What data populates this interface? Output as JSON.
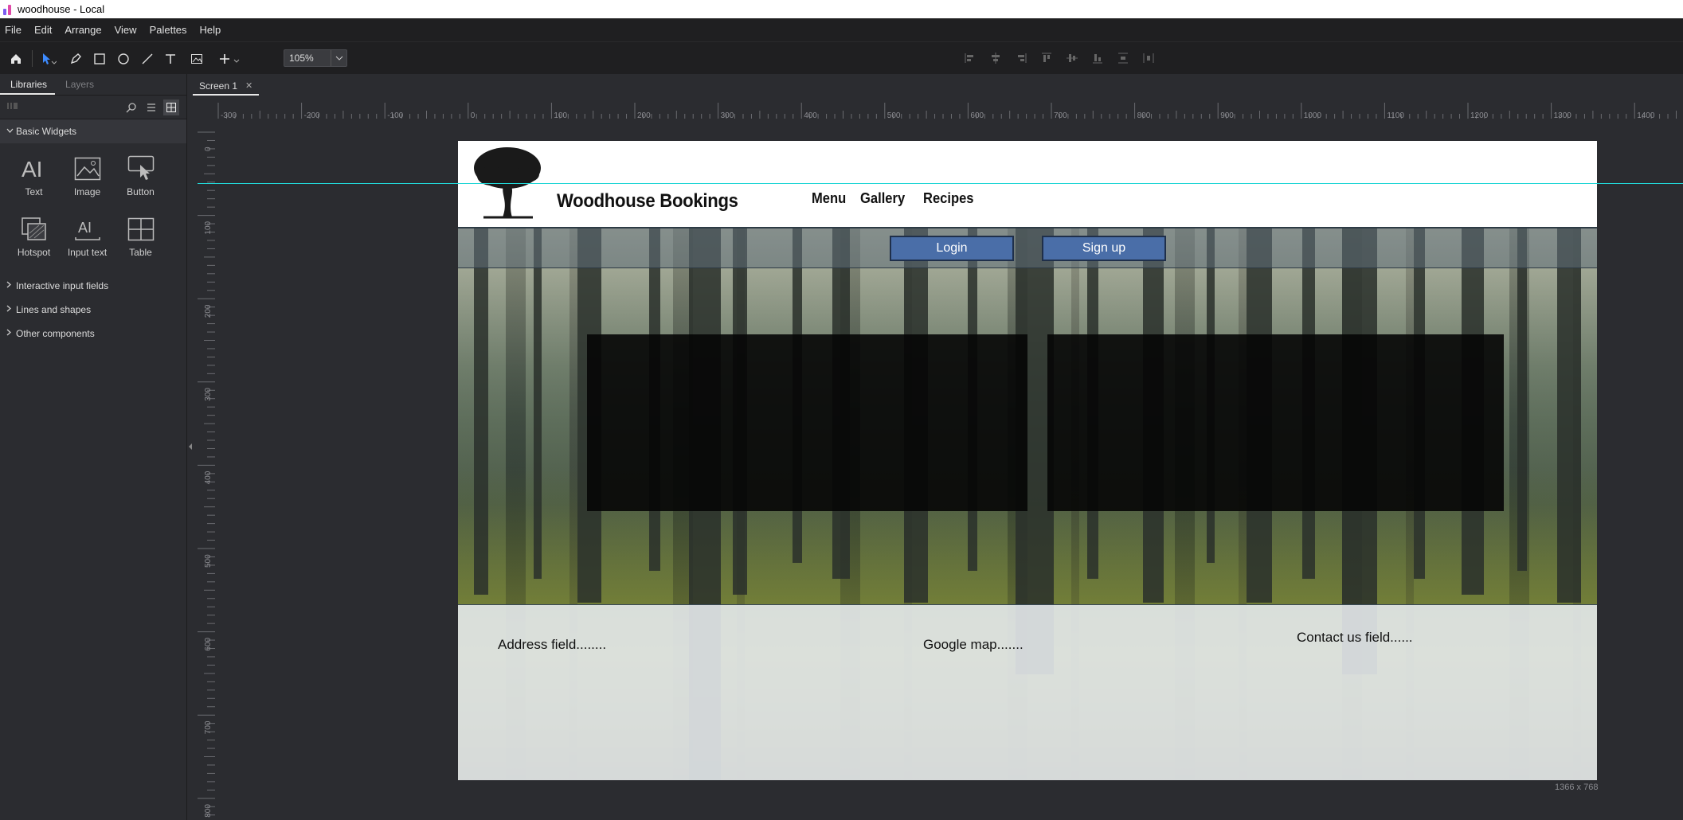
{
  "window": {
    "title": "woodhouse - Local"
  },
  "menubar": {
    "items": [
      "File",
      "Edit",
      "Arrange",
      "View",
      "Palettes",
      "Help"
    ]
  },
  "toolbar": {
    "zoom_value": "105%"
  },
  "left_panel": {
    "tabs": [
      {
        "label": "Libraries",
        "active": true
      },
      {
        "label": "Layers",
        "active": false
      }
    ],
    "sections": {
      "basic_widgets": "Basic Widgets",
      "interactive_inputs": "Interactive input fields",
      "lines_shapes": "Lines and shapes",
      "other_components": "Other components"
    },
    "widgets": [
      {
        "label": "Text",
        "icon": "text-widget-icon"
      },
      {
        "label": "Image",
        "icon": "image-widget-icon"
      },
      {
        "label": "Button",
        "icon": "button-widget-icon"
      },
      {
        "label": "Hotspot",
        "icon": "hotspot-widget-icon"
      },
      {
        "label": "Input text",
        "icon": "input-text-widget-icon"
      },
      {
        "label": "Table",
        "icon": "table-widget-icon"
      }
    ]
  },
  "document": {
    "tab_label": "Screen 1",
    "size_label": "1366 x 768"
  },
  "rulers": {
    "horizontal": [
      "-300",
      "-200",
      "-100",
      "0",
      "100",
      "200",
      "300",
      "400",
      "500",
      "600",
      "700",
      "800",
      "900",
      "1000",
      "1100",
      "1200",
      "1300",
      "1400"
    ],
    "vertical": [
      "0",
      "100",
      "200",
      "300",
      "400",
      "500",
      "600",
      "700",
      "800"
    ]
  },
  "site": {
    "brand": "Woodhouse Bookings",
    "nav": [
      "Menu",
      "Gallery",
      "Recipes"
    ],
    "login_label": "Login",
    "signup_label": "Sign up",
    "footer": {
      "address": "Address field........",
      "map": "Google map.......",
      "contact": "Contact us field......"
    },
    "colors": {
      "button": "#4a6ea8",
      "guide": "#22d6d6"
    }
  }
}
